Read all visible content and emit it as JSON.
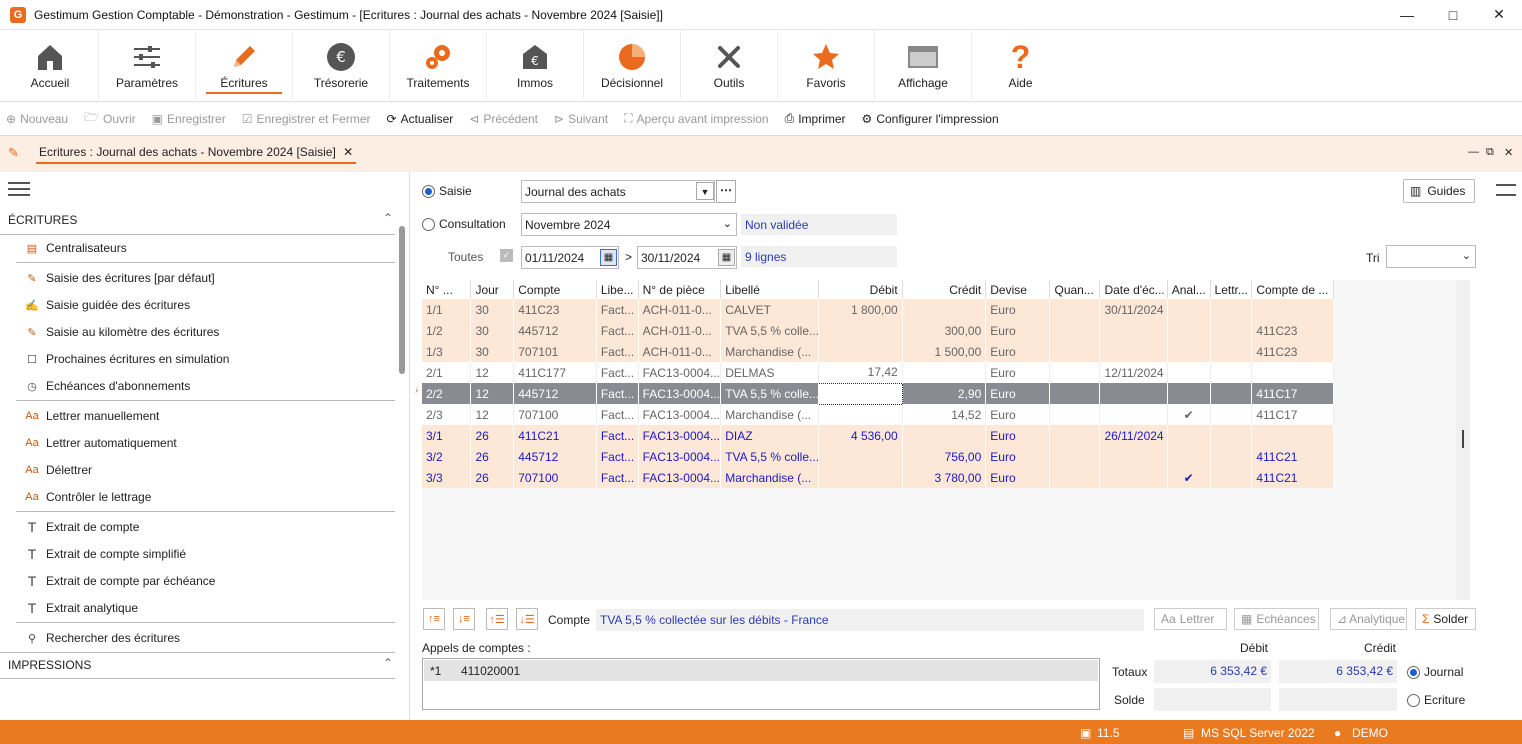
{
  "window": {
    "title": "Gestimum Gestion Comptable - Démonstration - Gestimum - [Ecritures : Journal des achats - Novembre 2024 [Saisie]]"
  },
  "ribbon": [
    {
      "label": "Accueil",
      "icon": "home-icon"
    },
    {
      "label": "Paramètres",
      "icon": "sliders-icon"
    },
    {
      "label": "Écritures",
      "icon": "pencil-icon"
    },
    {
      "label": "Trésorerie",
      "icon": "euro-icon"
    },
    {
      "label": "Traitements",
      "icon": "gears-icon"
    },
    {
      "label": "Immos",
      "icon": "building-euro-icon"
    },
    {
      "label": "Décisionnel",
      "icon": "pie-chart-icon"
    },
    {
      "label": "Outils",
      "icon": "tools-icon"
    },
    {
      "label": "Favoris",
      "icon": "star-icon"
    },
    {
      "label": "Affichage",
      "icon": "window-icon"
    },
    {
      "label": "Aide",
      "icon": "question-icon"
    }
  ],
  "toolbar": [
    {
      "label": "Nouveau",
      "enabled": false
    },
    {
      "label": "Ouvrir",
      "enabled": false
    },
    {
      "label": "Enregistrer",
      "enabled": false
    },
    {
      "label": "Enregistrer et Fermer",
      "enabled": false
    },
    {
      "label": "Actualiser",
      "enabled": true
    },
    {
      "label": "Précédent",
      "enabled": false
    },
    {
      "label": "Suivant",
      "enabled": false
    },
    {
      "label": "Aperçu avant impression",
      "enabled": false
    },
    {
      "label": "Imprimer",
      "enabled": true
    },
    {
      "label": "Configurer l'impression",
      "enabled": true
    }
  ],
  "doc_tab": {
    "title": "Ecritures : Journal des achats - Novembre 2024 [Saisie]"
  },
  "left": {
    "section1": "ÉCRITURES",
    "items": [
      "Centralisateurs",
      "Saisie des écritures [par défaut]",
      "Saisie guidée des écritures",
      "Saisie au kilomètre des écritures",
      "Prochaines écritures en simulation",
      "Echéances d'abonnements",
      "Lettrer manuellement",
      "Lettrer automatiquement",
      "Délettrer",
      "Contrôler le lettrage",
      "Extrait de compte",
      "Extrait de compte simplifié",
      "Extrait de compte par échéance",
      "Extrait analytique",
      "Rechercher des écritures"
    ],
    "section2": "IMPRESSIONS"
  },
  "filters": {
    "saisie_label": "Saisie",
    "journal": "Journal des achats",
    "consultation_label": "Consultation",
    "period": "Novembre 2024",
    "status": "Non validée",
    "toutes_label": "Toutes",
    "date_from": "01/11/2024",
    "date_sep": ">",
    "date_to": "30/11/2024",
    "lines": "9 lignes",
    "guides_label": "Guides",
    "tri_label": "Tri"
  },
  "grid": {
    "headers": [
      "N° ...",
      "Jour",
      "Compte",
      "Libe...",
      "N° de pièce",
      "Libellé",
      "Débit",
      "Crédit",
      "Devise",
      "Quan...",
      "Date d'éc...",
      "Anal...",
      "Lettr...",
      "Compte de ..."
    ],
    "rows": [
      {
        "style": "peach dim",
        "cells": [
          "1/1",
          "30",
          "411C23",
          "Fact...",
          "ACH-011-0...",
          "CALVET",
          "1 800,00",
          "",
          "Euro",
          "",
          "30/11/2024",
          "",
          "",
          ""
        ]
      },
      {
        "style": "peach dim",
        "cells": [
          "1/2",
          "30",
          "445712",
          "Fact...",
          "ACH-011-0...",
          "TVA 5,5 % colle...",
          "",
          "300,00",
          "Euro",
          "",
          "",
          "",
          "",
          "411C23"
        ]
      },
      {
        "style": "peach dim",
        "cells": [
          "1/3",
          "30",
          "707101",
          "Fact...",
          "ACH-011-0...",
          "Marchandise (...",
          "",
          "1 500,00",
          "Euro",
          "",
          "",
          "",
          "",
          "411C23"
        ]
      },
      {
        "style": "white dim",
        "cells": [
          "2/1",
          "12",
          "411C177",
          "Fact...",
          "FAC13-0004...",
          "DELMAS",
          "17,42",
          "",
          "Euro",
          "",
          "12/11/2024",
          "",
          "",
          ""
        ]
      },
      {
        "style": "sel",
        "cells": [
          "2/2",
          "12",
          "445712",
          "Fact...",
          "FAC13-0004...",
          "TVA 5,5 % colle...",
          "",
          "2,90",
          "Euro",
          "",
          "",
          "",
          "",
          "411C17"
        ]
      },
      {
        "style": "white dim",
        "cells": [
          "2/3",
          "12",
          "707100",
          "Fact...",
          "FAC13-0004...",
          "Marchandise (...",
          "",
          "14,52",
          "Euro",
          "",
          "",
          "✔",
          "",
          "411C17"
        ]
      },
      {
        "style": "peach blue",
        "cells": [
          "3/1",
          "26",
          "411C21",
          "Fact...",
          "FAC13-0004...",
          "DIAZ",
          "4 536,00",
          "",
          "Euro",
          "",
          "26/11/2024",
          "",
          "",
          ""
        ]
      },
      {
        "style": "peach blue",
        "cells": [
          "3/2",
          "26",
          "445712",
          "Fact...",
          "FAC13-0004...",
          "TVA 5,5 % colle...",
          "",
          "756,00",
          "Euro",
          "",
          "",
          "",
          "",
          "411C21"
        ]
      },
      {
        "style": "peach blue",
        "cells": [
          "3/3",
          "26",
          "707100",
          "Fact...",
          "FAC13-0004...",
          "Marchandise (...",
          "",
          "3 780,00",
          "Euro",
          "",
          "",
          "✔",
          "",
          "411C21"
        ]
      }
    ]
  },
  "bottom": {
    "compte_label": "Compte",
    "compte_value": "TVA 5,5 % collectée sur les débits - France",
    "lettrer": "Lettrer",
    "echeances": "Echéances",
    "analytique": "Analytique",
    "solder": "Solder",
    "appels_label": "Appels de comptes :",
    "appel_key": "*1",
    "appel_value": "411020001",
    "debit_label": "Débit",
    "credit_label": "Crédit",
    "totaux_label": "Totaux",
    "totaux_debit": "6 353,42 €",
    "totaux_credit": "6 353,42 €",
    "solde_label": "Solde",
    "journal_label": "Journal",
    "ecriture_label": "Ecriture"
  },
  "status": {
    "version": "11.5",
    "server": "MS SQL Server 2022",
    "user": "DEMO"
  }
}
